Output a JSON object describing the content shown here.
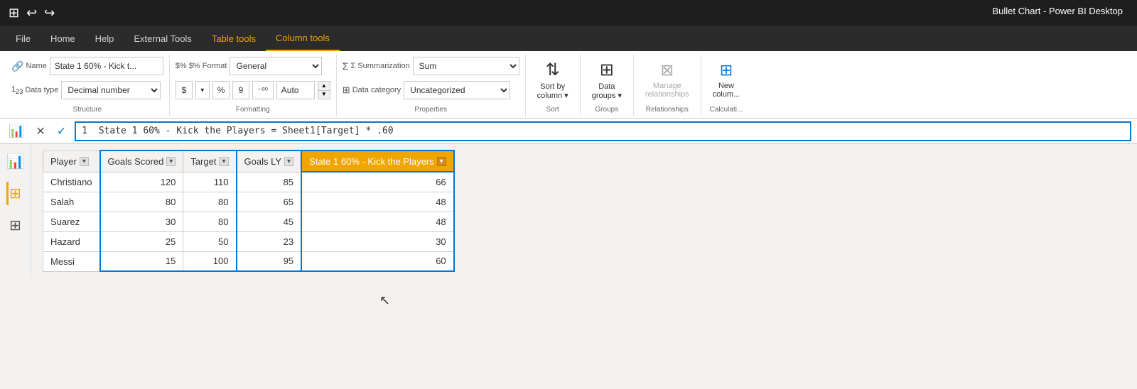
{
  "titleBar": {
    "title": "Bullet Chart - Power BI Desktop",
    "icons": [
      "save",
      "undo",
      "redo"
    ]
  },
  "menuBar": {
    "items": [
      {
        "id": "file",
        "label": "File"
      },
      {
        "id": "home",
        "label": "Home"
      },
      {
        "id": "help",
        "label": "Help"
      },
      {
        "id": "external-tools",
        "label": "External Tools"
      },
      {
        "id": "table-tools",
        "label": "Table tools"
      },
      {
        "id": "column-tools",
        "label": "Column tools",
        "active": true
      }
    ]
  },
  "ribbon": {
    "groups": {
      "structure": {
        "label": "Structure",
        "nameLabel": "Name",
        "nameIcon": "🔗",
        "nameValue": "State 1 60% - Kick t...",
        "dataTypeLabel": "Data type",
        "dataTypeIcon": "1.23",
        "dataTypeValue": "Decimal number"
      },
      "formatting": {
        "label": "Formatting",
        "formatLabel": "$% Format",
        "formatValue": "General",
        "currencySymbol": "$",
        "percentSymbol": "%",
        "commaSymbol": "9",
        "decimalSymbol": "-00",
        "autoLabel": "Auto"
      },
      "properties": {
        "label": "Properties",
        "summarizationLabel": "Σ Summarization",
        "summarizationValue": "Sum",
        "dataCategoryLabel": "Data category",
        "dataCategoryValue": "Uncategorized"
      },
      "sort": {
        "label": "Sort",
        "sortByColumnLabel": "Sort by\ncolumn ▾"
      },
      "groups": {
        "label": "Groups",
        "dataGroupsLabel": "Data\ngroups ▾"
      },
      "relationships": {
        "label": "Relationships",
        "manageLabel": "Manage\nrelationships"
      },
      "calculations": {
        "label": "Calculati...",
        "newColumnLabel": "New\ncolum..."
      }
    }
  },
  "formulaBar": {
    "cancelLabel": "✕",
    "confirmLabel": "✓",
    "formula": "1  State 1 60% - Kick the Players = Sheet1[Target] * .60"
  },
  "sidebar": {
    "icons": [
      "report",
      "table",
      "model"
    ]
  },
  "table": {
    "columns": [
      {
        "id": "player",
        "label": "Player",
        "hasFilter": true
      },
      {
        "id": "goals-scored",
        "label": "Goals Scored",
        "hasFilter": true
      },
      {
        "id": "target",
        "label": "Target",
        "hasFilter": true
      },
      {
        "id": "goals-ly",
        "label": "Goals LY",
        "hasFilter": true
      },
      {
        "id": "state-60",
        "label": "State 1 60% - Kick the Players",
        "hasFilter": true,
        "highlighted": true
      }
    ],
    "rows": [
      {
        "player": "Christiano",
        "goalsScored": 120,
        "target": 110,
        "goalsLY": 85,
        "state60": 66
      },
      {
        "player": "Salah",
        "goalsScored": 80,
        "target": 80,
        "goalsLY": 65,
        "state60": 48
      },
      {
        "player": "Suarez",
        "goalsScored": 30,
        "target": 80,
        "goalsLY": 45,
        "state60": 48
      },
      {
        "player": "Hazard",
        "goalsScored": 25,
        "target": 50,
        "goalsLY": 23,
        "state60": 30
      },
      {
        "player": "Messi",
        "goalsScored": 15,
        "target": 100,
        "goalsLY": 95,
        "state60": 60
      }
    ]
  }
}
